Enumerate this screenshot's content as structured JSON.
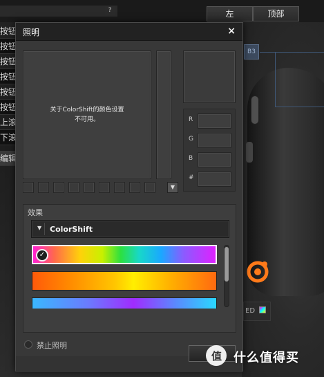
{
  "background": {
    "tab_left": "左",
    "tab_top": "顶部",
    "help_glyph": "?",
    "b3_badge": "B3",
    "ed_label": "ED",
    "side_items": [
      "按钮",
      "按钮",
      "按钮",
      "按钮",
      "按钮",
      "按钮",
      "上滚",
      "下滚"
    ],
    "side_edit": "编辑"
  },
  "dialog": {
    "title": "照明",
    "close_glyph": "×",
    "color_message_line1": "关于ColorShift的颜色设置",
    "color_message_line2": "不可用。",
    "rgb": [
      {
        "label": "R",
        "value": ""
      },
      {
        "label": "G",
        "value": ""
      },
      {
        "label": "B",
        "value": ""
      },
      {
        "label": "#",
        "value": ""
      }
    ],
    "swatch_dropdown_glyph": "▼",
    "effect_label": "效果",
    "effect_arrow_glyph": "▼",
    "effect_selected": "ColorShift",
    "check_glyph": "✓",
    "disable_label": "禁止照明",
    "ok_label": ""
  },
  "watermark": {
    "logo_glyph": "值",
    "text": "什么值得买"
  },
  "colors": {
    "accent_border": "#f5f5f5",
    "b3_blue": "#3c4a5e",
    "logo_orange": "#ff7a1a"
  },
  "icons": {
    "close": "close-icon",
    "check": "check-icon",
    "dropdown": "chevron-down-icon",
    "mouse_logo": "steelseries-logo-icon"
  }
}
